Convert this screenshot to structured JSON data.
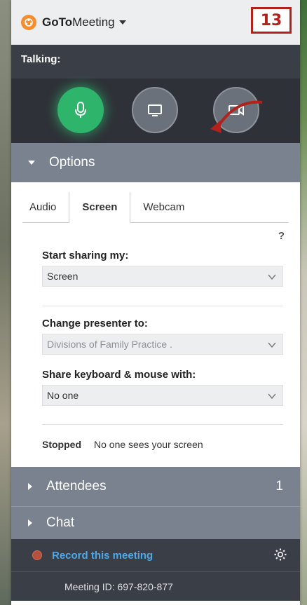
{
  "window": {
    "title_bold": "GoTo",
    "title_rest": "Meeting",
    "icons": [
      "gotomeeting-logo-icon",
      "dropdown-caret-icon",
      "collapse-icon",
      "close-icon"
    ],
    "close_glyph": "✕"
  },
  "talking": {
    "label": "Talking:"
  },
  "controls": {
    "icons": [
      "microphone-icon",
      "screen-share-icon",
      "webcam-icon"
    ],
    "mic_color": "#2fb46b"
  },
  "callout": {
    "number": "13",
    "color": "#b3211c"
  },
  "options": {
    "header": "Options",
    "tabs": [
      {
        "label": "Audio"
      },
      {
        "label": "Screen"
      },
      {
        "label": "Webcam"
      }
    ],
    "active_tab": "Screen",
    "help": "?",
    "start_sharing": {
      "label": "Start sharing my:",
      "value": "Screen"
    },
    "change_presenter": {
      "label": "Change presenter to:",
      "value": "Divisions of Family Practice ."
    },
    "share_keyboard": {
      "label": "Share keyboard & mouse with:",
      "value": "No one"
    },
    "status": {
      "state": "Stopped",
      "message": "No one sees your screen"
    }
  },
  "attendees": {
    "header": "Attendees",
    "count": "1"
  },
  "chat": {
    "header": "Chat"
  },
  "record": {
    "label": "Record this meeting",
    "link_color": "#4fa8e8"
  },
  "meeting": {
    "id_text": "Meeting ID: 697-820-877"
  }
}
